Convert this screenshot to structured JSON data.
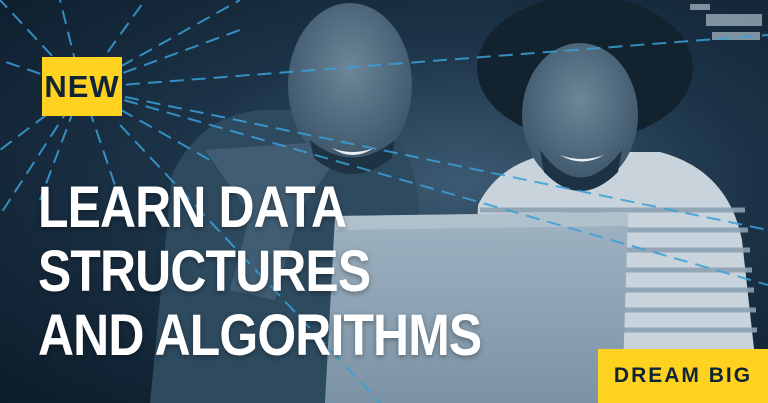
{
  "badge": {
    "label": "NEW"
  },
  "headline": {
    "line1": "LEARN DATA",
    "line2": "STRUCTURES",
    "line3": "AND ALGORITHMS"
  },
  "tagline": {
    "label": "DREAM BIG"
  },
  "colors": {
    "accent": "#ffd21f",
    "background": "#0c1b2a",
    "tint": "#3c5a72",
    "line": "#3aa0d8"
  }
}
